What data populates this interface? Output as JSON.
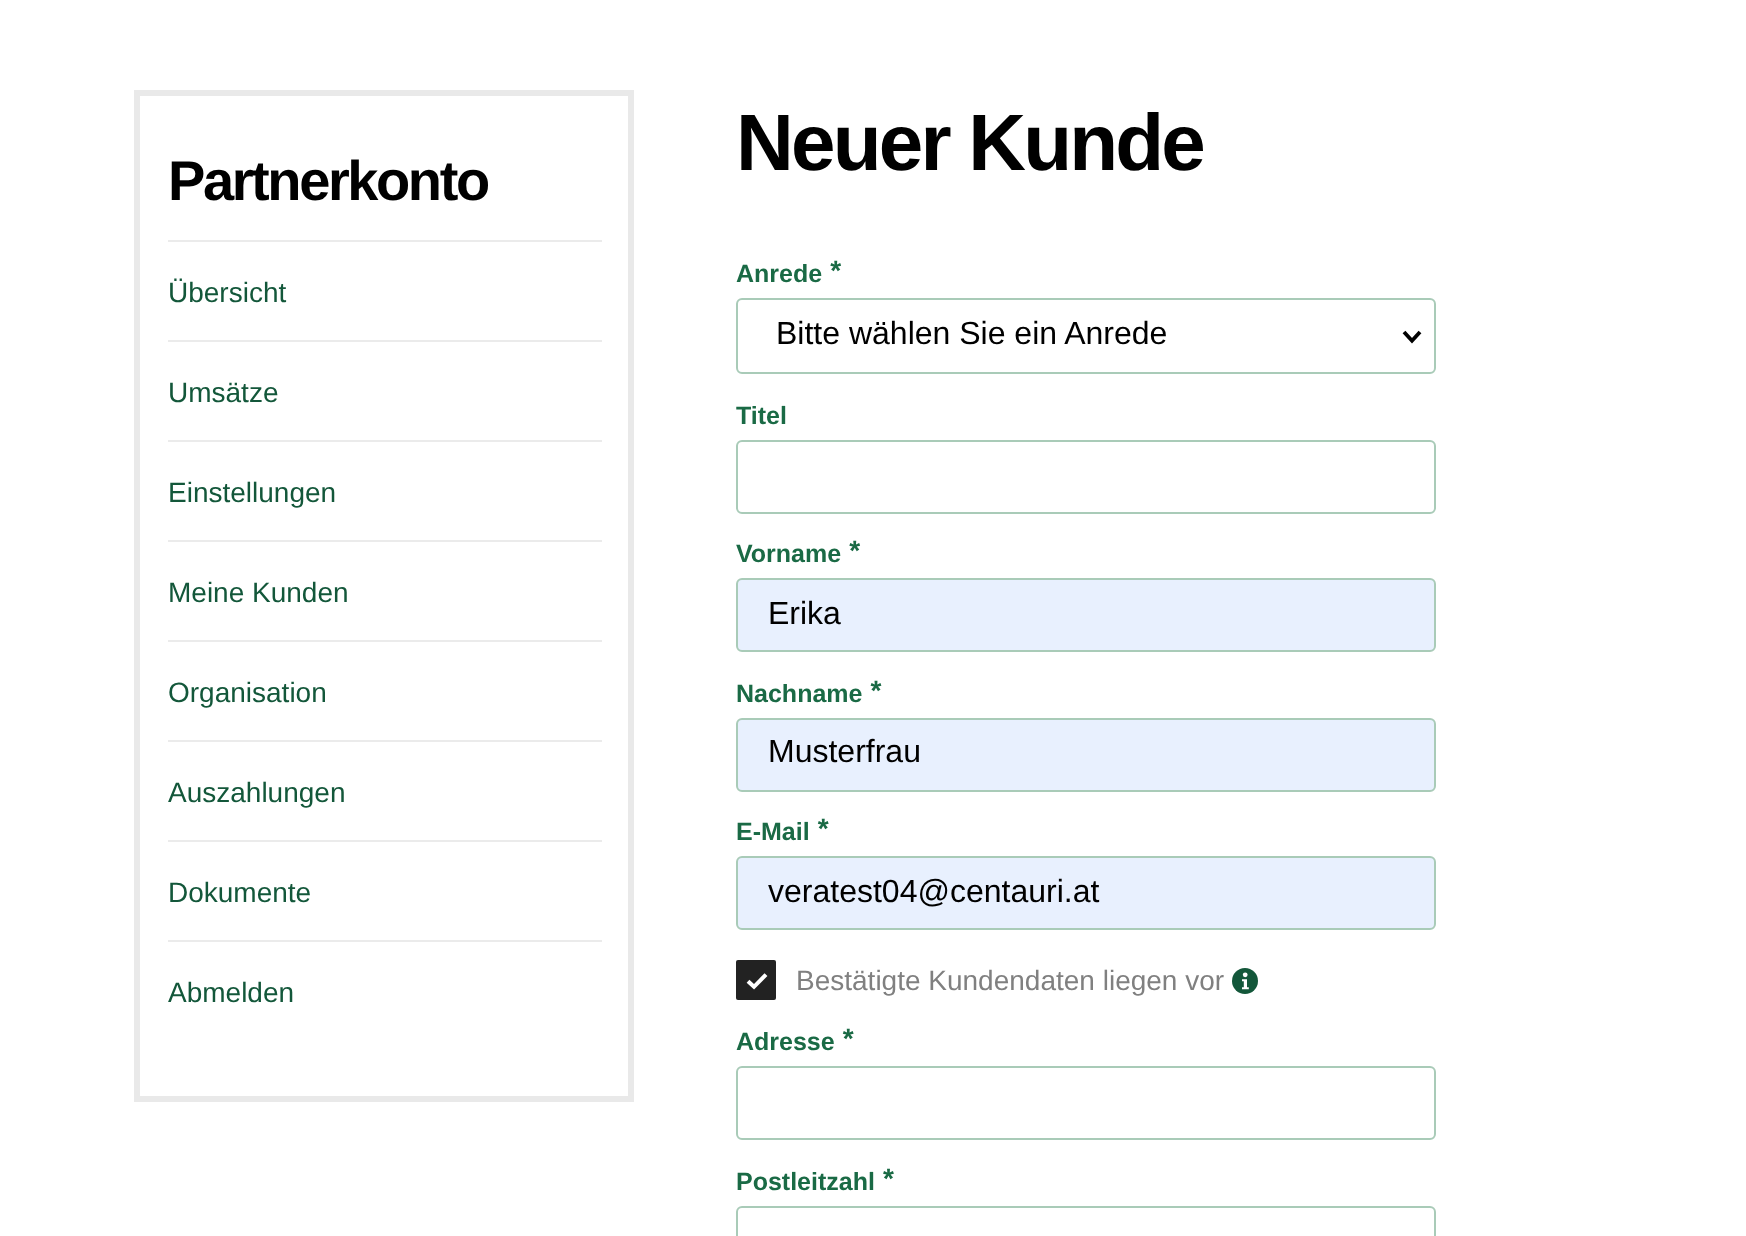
{
  "sidebar": {
    "title": "Partnerkonto",
    "items": [
      {
        "label": "Übersicht"
      },
      {
        "label": "Umsätze"
      },
      {
        "label": "Einstellungen"
      },
      {
        "label": "Meine Kunden"
      },
      {
        "label": "Organisation"
      },
      {
        "label": "Auszahlungen"
      },
      {
        "label": "Dokumente"
      },
      {
        "label": "Abmelden"
      }
    ]
  },
  "page_title": "Neuer Kunde",
  "form": [
    {
      "kind": "select",
      "label": "Anrede",
      "required_mark": "*",
      "value": "Bitte wählen Sie ein Anrede"
    },
    {
      "kind": "text",
      "label": "Titel",
      "autofilled": false
    },
    {
      "kind": "text",
      "label": "Vorname",
      "required_mark": "*",
      "value": "Erika",
      "autofilled": true
    },
    {
      "kind": "text",
      "label": "Nachname",
      "required_mark": "*",
      "value": "Musterfrau",
      "autofilled": true
    },
    {
      "kind": "text",
      "label": "E-Mail",
      "required_mark": "*",
      "value": "veratest04@centauri.at",
      "autofilled": true
    },
    {
      "kind": "checkbox",
      "label": "Bestätigte Kundendaten liegen vor",
      "checked": true
    },
    {
      "kind": "text",
      "label": "Adresse",
      "required_mark": "*",
      "autofilled": false
    },
    {
      "kind": "text",
      "label": "Postleitzahl",
      "required_mark": "*",
      "autofilled": false
    }
  ]
}
